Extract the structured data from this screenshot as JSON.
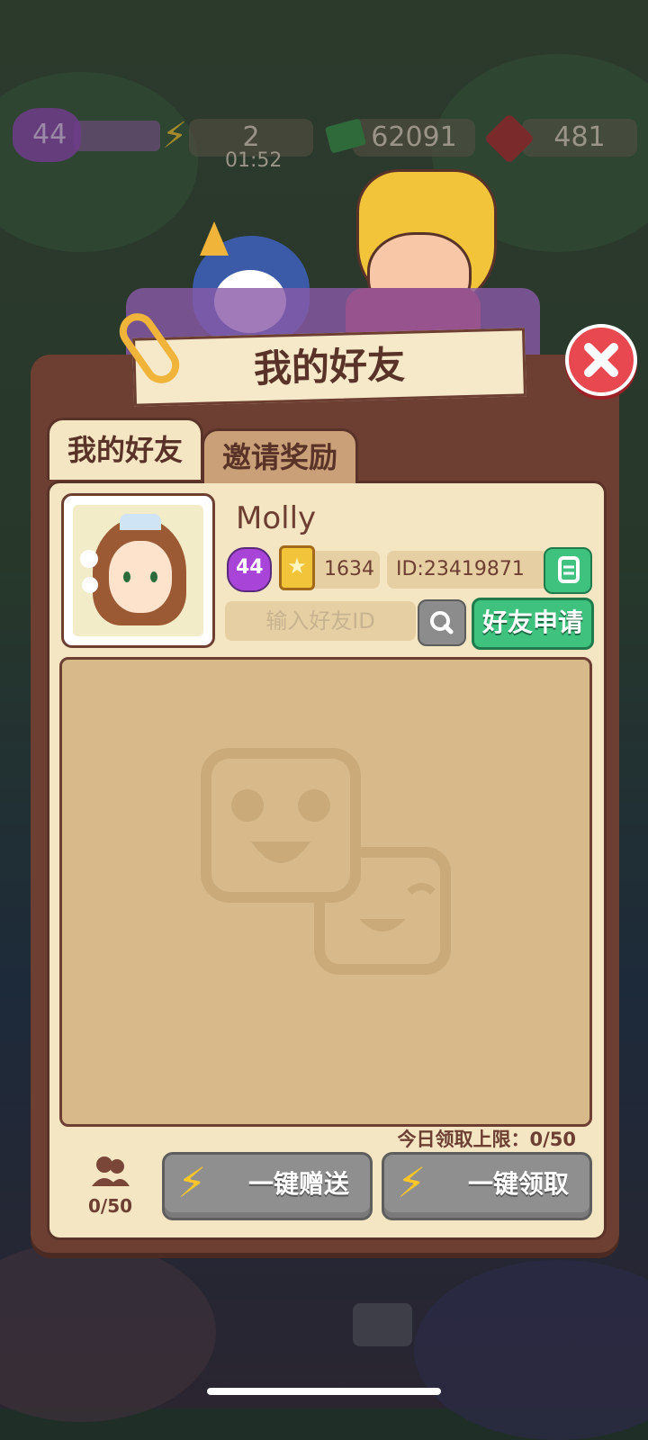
{
  "hud": {
    "level": "44",
    "energy": "2",
    "energy_timer": "01:52",
    "cash": "62091",
    "gems": "481"
  },
  "dialog": {
    "title": "我的好友",
    "tabs": [
      {
        "label": "我的好友",
        "active": true
      },
      {
        "label": "邀请奖励",
        "active": false
      }
    ]
  },
  "profile": {
    "name": "Molly",
    "level": "44",
    "stars": "1634",
    "id_text": "ID:23419871"
  },
  "search": {
    "placeholder": "输入好友ID",
    "apply_label": "好友申请"
  },
  "footer": {
    "daily_limit": "今日领取上限：0/50",
    "friend_count": "0/50",
    "send_all_label": "一键赠送",
    "claim_all_label": "一键领取"
  },
  "colors": {
    "panel": "#6d3f33",
    "paper": "#f4e5c3",
    "green_button": "#3fc27e",
    "gray_button": "#8f8f8f",
    "close_red": "#e8484f"
  }
}
